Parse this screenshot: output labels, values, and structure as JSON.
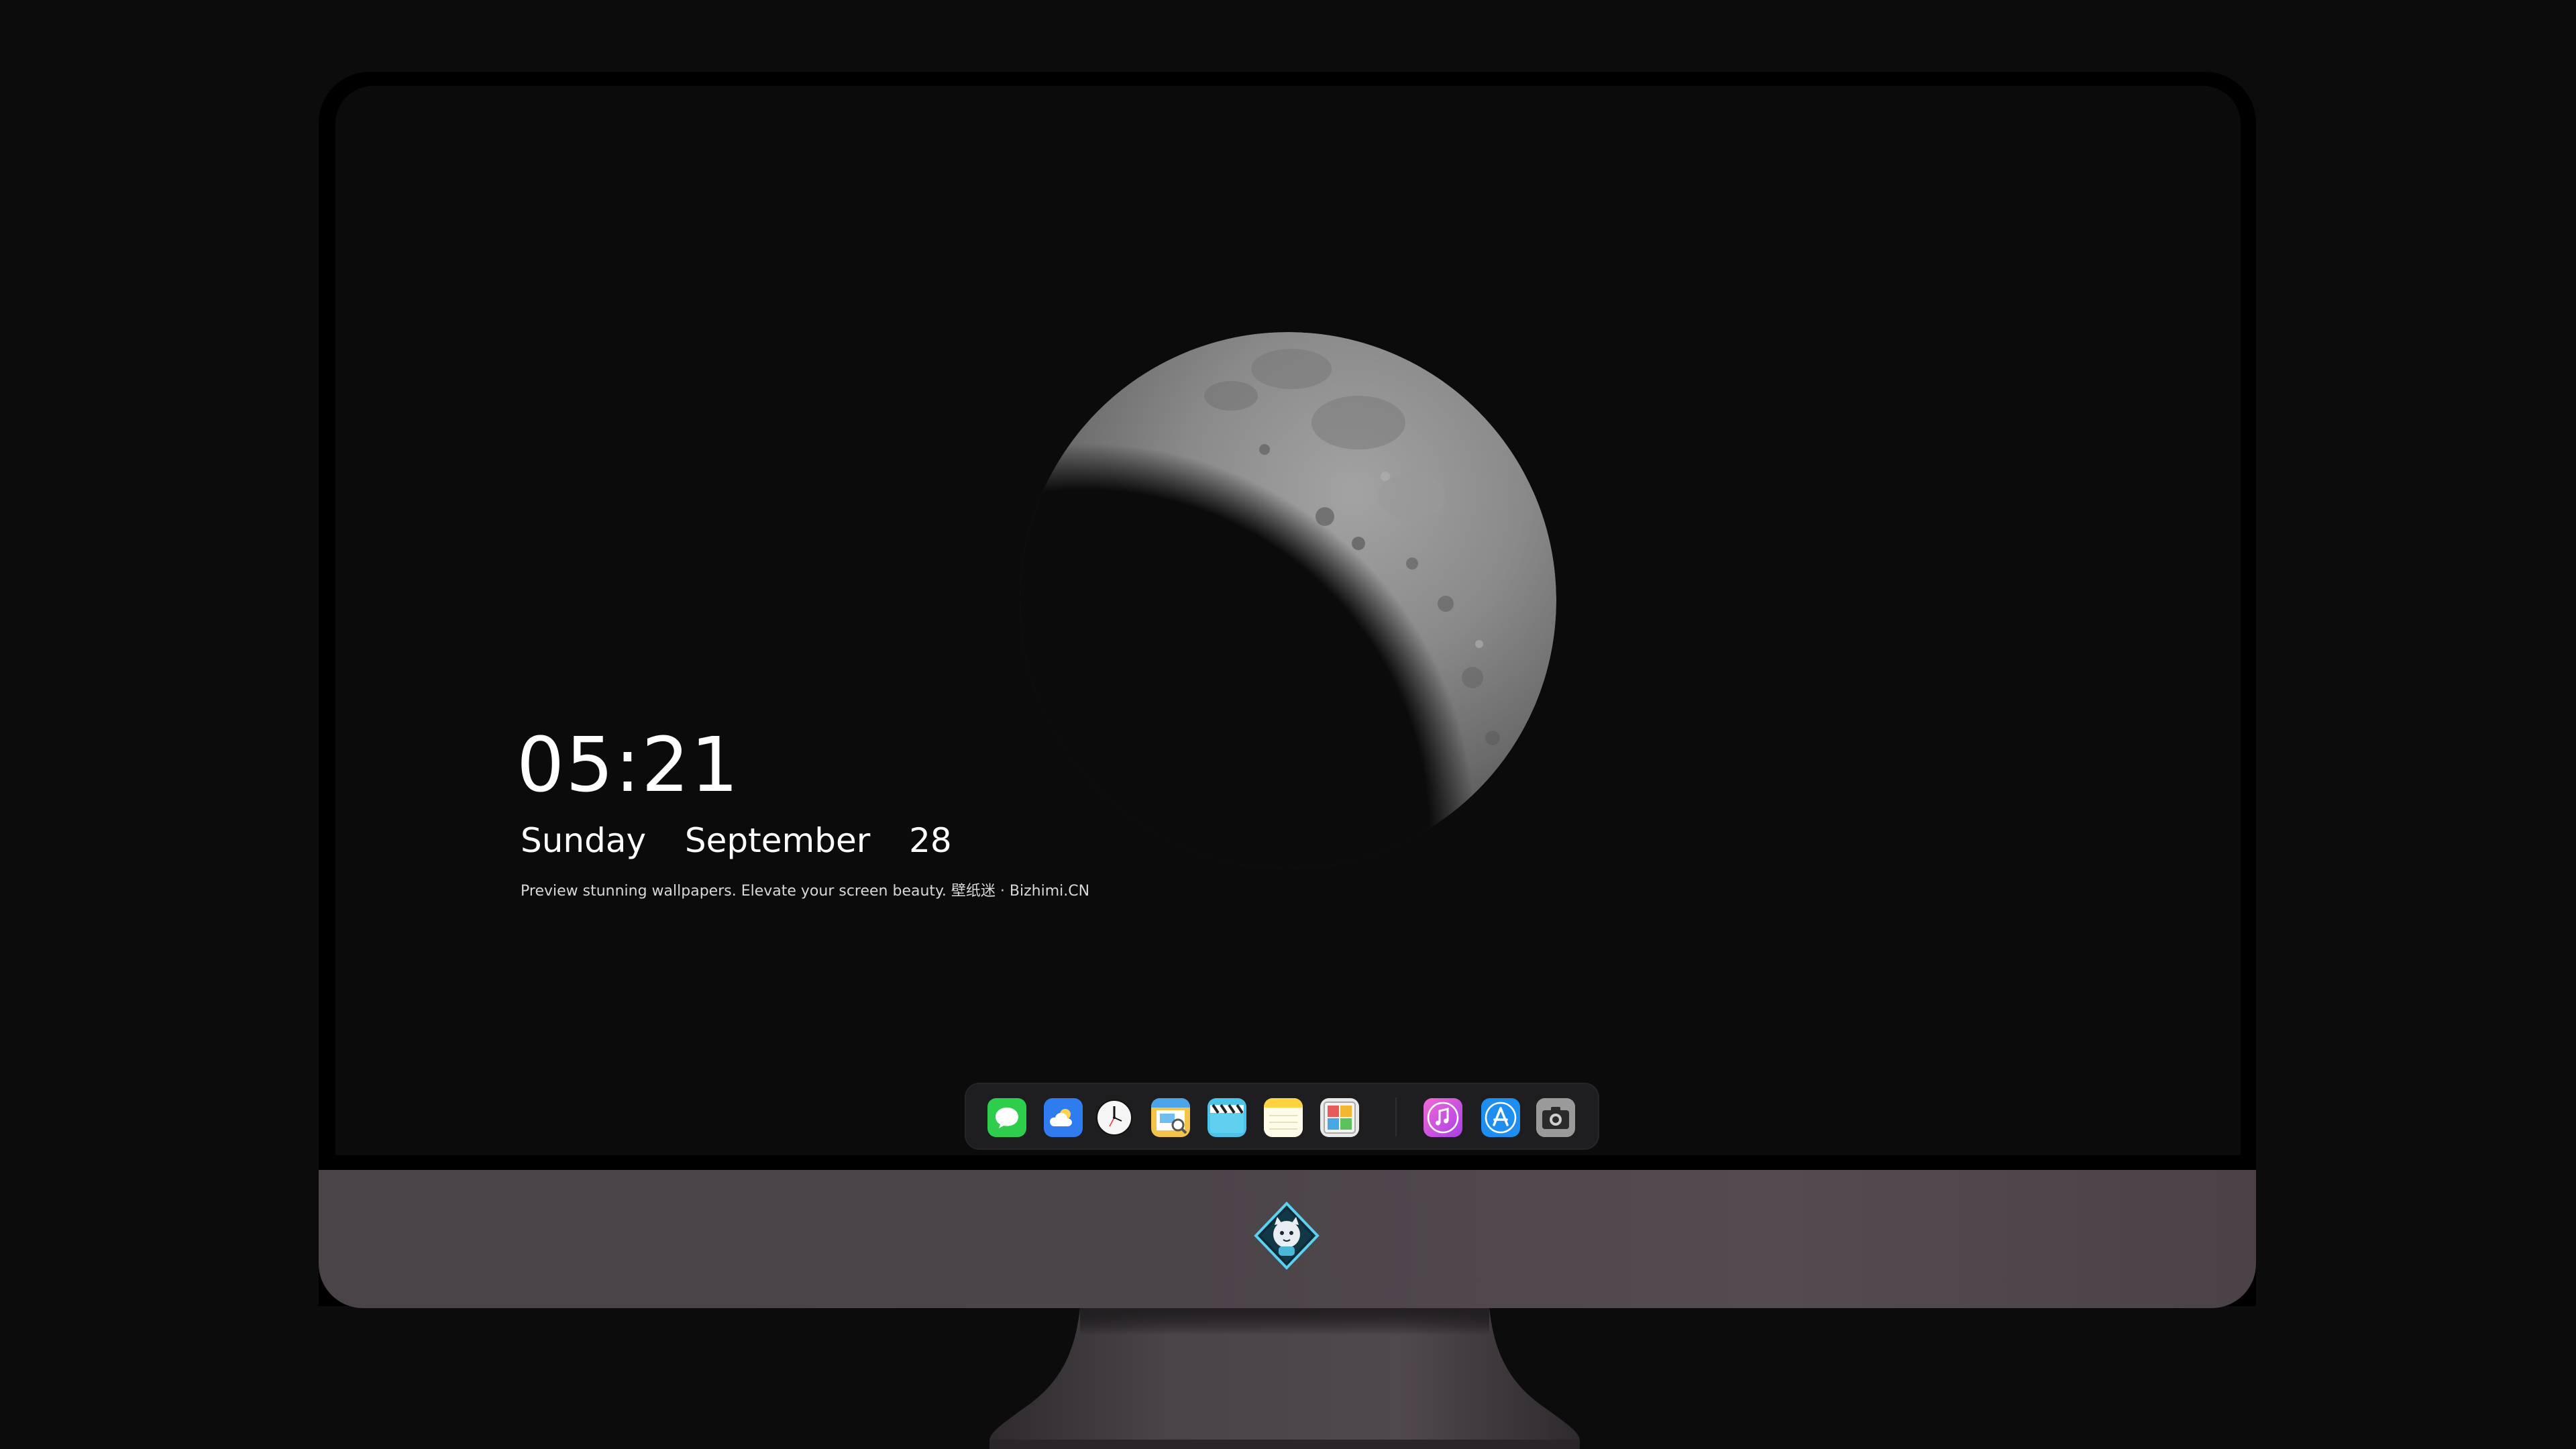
{
  "lock_screen": {
    "time": "05:21",
    "weekday": "Sunday",
    "month": "September",
    "day": "28",
    "caption": "Preview stunning wallpapers. Elevate your screen beauty. 壁纸迷 · Bizhimi.CN"
  },
  "dock": {
    "items": [
      {
        "icon": "messages-icon",
        "color": "#2fcd4c"
      },
      {
        "icon": "weather-icon",
        "color": "#2f7cf0"
      },
      {
        "icon": "clock-icon",
        "color": "#f2f2f2"
      },
      {
        "icon": "preview-icon",
        "color": "#f3c34a"
      },
      {
        "icon": "clips-icon",
        "color": "#4cc3e8"
      },
      {
        "icon": "notes-icon",
        "color": "#ffd23f"
      },
      {
        "icon": "photo-booth-icon",
        "color": "#e9e9e9"
      },
      {
        "icon": "music-icon",
        "color": "#d94be3"
      },
      {
        "icon": "app-store-icon",
        "color": "#1f8ef1"
      },
      {
        "icon": "camera-icon",
        "color": "#8a8a8a"
      }
    ]
  },
  "colors": {
    "background": "#0c0c0d",
    "screen": "#0b0b0b",
    "chin": "#4b4449",
    "text": "#ffffff"
  }
}
